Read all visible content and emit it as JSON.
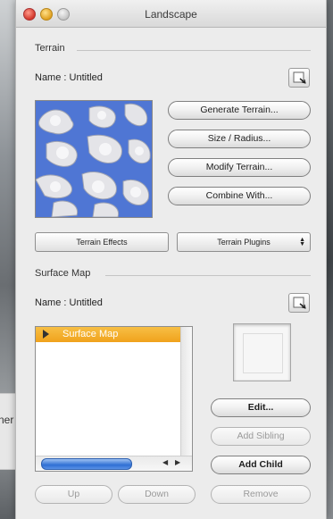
{
  "window": {
    "title": "Landscape"
  },
  "background": {
    "partial_label": "ner"
  },
  "terrain": {
    "section_label": "Terrain",
    "name_label": "Name : Untitled",
    "buttons": {
      "generate": "Generate Terrain...",
      "size_radius": "Size / Radius...",
      "modify": "Modify Terrain...",
      "combine": "Combine With..."
    },
    "effects_label": "Terrain Effects",
    "plugins_label": "Terrain Plugins"
  },
  "surface_map": {
    "section_label": "Surface Map",
    "name_label": "Name : Untitled",
    "tree_items": [
      {
        "label": "Surface Map",
        "selected": true
      }
    ],
    "buttons": {
      "edit": "Edit...",
      "add_sibling": "Add Sibling",
      "add_child": "Add Child"
    }
  },
  "bottom_buttons": {
    "up": "Up",
    "down": "Down",
    "remove": "Remove"
  },
  "colors": {
    "selection": "#f0a21c",
    "scroll_thumb": "#2f6fd4",
    "preview_sky": "#4f76d4"
  }
}
